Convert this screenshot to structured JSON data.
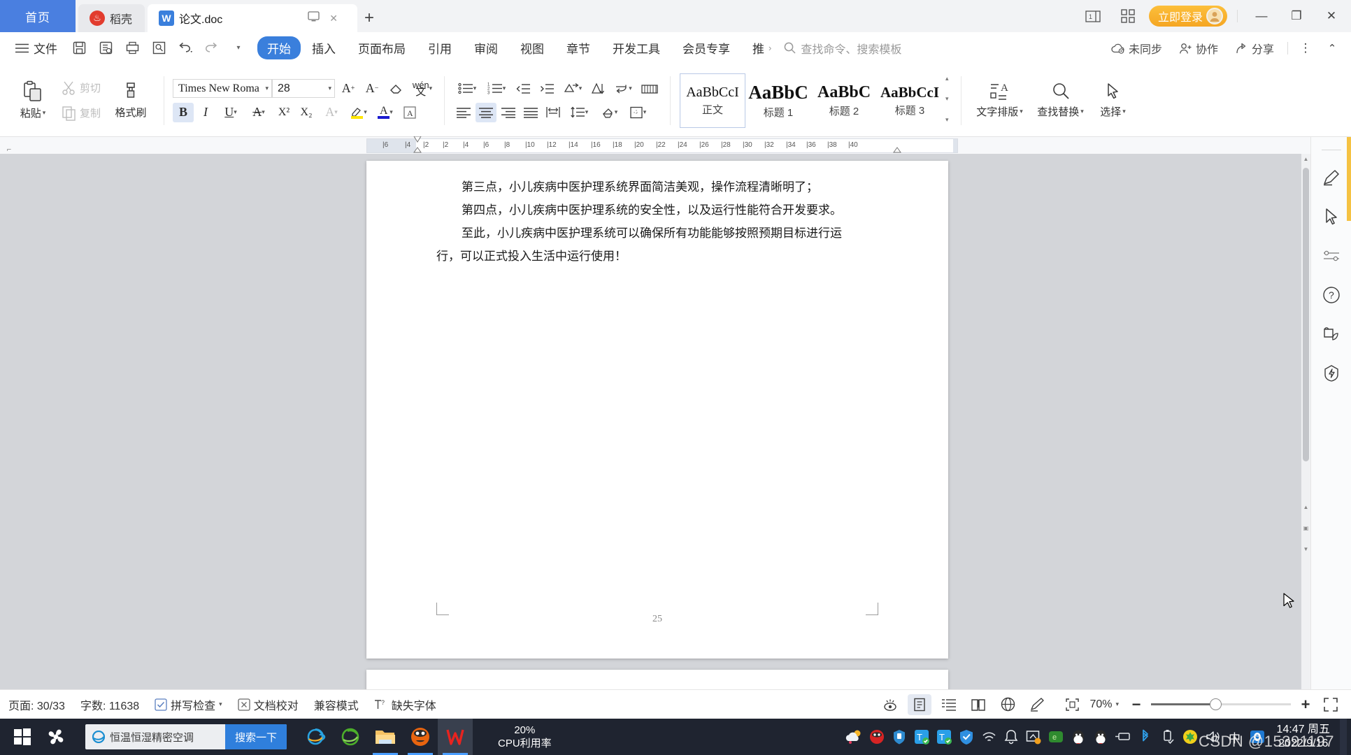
{
  "window": {
    "tabs": [
      {
        "id": "home",
        "label": "首页",
        "icon": "home-tab",
        "active": false
      },
      {
        "id": "docer",
        "label": "稻壳",
        "icon": "docer-icon",
        "active": false
      },
      {
        "id": "doc1",
        "label": "论文.doc",
        "icon": "wps-writer-icon",
        "active": true
      }
    ],
    "new_tab_label": "+",
    "cast_icon": "cast-icon",
    "layout_icon": "single-page-layout-icon",
    "grid_icon": "app-grid-icon",
    "login_label": "立即登录",
    "minimize": "—",
    "maximize": "❐",
    "close": "✕"
  },
  "menubar": {
    "file_label": "文件",
    "quick_access": [
      "save-icon",
      "save-as-icon",
      "print-icon",
      "print-preview-icon",
      "undo-icon",
      "redo-icon",
      "customize-icon"
    ],
    "items": [
      {
        "label": "开始",
        "active": true
      },
      {
        "label": "插入",
        "active": false
      },
      {
        "label": "页面布局",
        "active": false
      },
      {
        "label": "引用",
        "active": false
      },
      {
        "label": "审阅",
        "active": false
      },
      {
        "label": "视图",
        "active": false
      },
      {
        "label": "章节",
        "active": false
      },
      {
        "label": "开发工具",
        "active": false
      },
      {
        "label": "会员专享",
        "active": false
      },
      {
        "label": "推",
        "active": false
      }
    ],
    "overflow_label": "›",
    "search_placeholder": "查找命令、搜索模板",
    "right_items": [
      {
        "label": "未同步",
        "icon": "cloud-sync-icon"
      },
      {
        "label": "协作",
        "icon": "collaborate-icon"
      },
      {
        "label": "分享",
        "icon": "share-icon"
      }
    ],
    "more_icon": "more-vertical-icon",
    "collapse_icon": "collapse-ribbon-icon"
  },
  "ribbon": {
    "clipboard": {
      "paste_label": "粘贴",
      "cut_label": "剪切",
      "copy_label": "复制",
      "format_painter_label": "格式刷"
    },
    "font": {
      "family": "Times New Roma",
      "size": "28",
      "grow_icon": "increase-font-size-icon",
      "shrink_icon": "decrease-font-size-icon",
      "clear_format_icon": "clear-formatting-icon",
      "pinyin_icon": "pinyin-guide-icon",
      "bold": "B",
      "italic": "I",
      "underline": "U",
      "strikethrough": "A",
      "superscript": "X²",
      "subscript": "X₂",
      "text_effects": "A",
      "highlight_icon": "highlight-color-icon",
      "font_color_icon": "font-color-icon",
      "char_border_icon": "character-border-icon",
      "bold_active": true
    },
    "paragraph": {
      "bullets_icon": "bullet-list-icon",
      "numbering_icon": "numbered-list-icon",
      "decrease_indent_icon": "decrease-indent-icon",
      "increase_indent_icon": "increase-indent-icon",
      "smart_layout_icon": "smart-typography-icon",
      "sort_icon": "sort-icon",
      "show_marks_icon": "show-paragraph-marks-icon",
      "table_grid_icon": "table-grid-icon",
      "align_left_icon": "align-left-icon",
      "align_center_icon": "align-center-icon",
      "align_right_icon": "align-right-icon",
      "justify_icon": "justify-icon",
      "distribute_icon": "distribute-icon",
      "line_spacing_icon": "line-spacing-icon",
      "shading_icon": "shading-icon",
      "borders_icon": "borders-icon",
      "align_center_active": true
    },
    "styles": [
      {
        "preview": "AaBbCcI",
        "name": "正文",
        "selected": true,
        "size": "20px",
        "weight": "normal"
      },
      {
        "preview": "AaBbC",
        "name": "标题 1",
        "selected": false,
        "size": "27px",
        "weight": "bold"
      },
      {
        "preview": "AaBbC",
        "name": "标题 2",
        "selected": false,
        "size": "24px",
        "weight": "bold"
      },
      {
        "preview": "AaBbCcI",
        "name": "标题 3",
        "selected": false,
        "size": "21px",
        "weight": "bold"
      }
    ],
    "text_layout_label": "文字排版",
    "find_replace_label": "查找替换",
    "select_label": "选择"
  },
  "ruler": {
    "ticks": [
      "6",
      "4",
      "2",
      "2",
      "4",
      "6",
      "8",
      "10",
      "12",
      "14",
      "16",
      "18",
      "20",
      "22",
      "24",
      "26",
      "28",
      "30",
      "32",
      "34",
      "36",
      "38",
      "40"
    ]
  },
  "document": {
    "paragraphs": [
      "第三点，小儿疾病中医护理系统界面简洁美观，操作流程清晰明了；",
      "第四点，小儿疾病中医护理系统的安全性，以及运行性能符合开发要求。",
      "至此，小儿疾病中医护理系统可以确保所有功能能够按照预期目标进行运",
      "行，可以正式投入生活中运行使用！"
    ],
    "page_number": "25"
  },
  "right_panel": {
    "items": [
      {
        "icon": "brush-pen-icon",
        "name": "style-brush"
      },
      {
        "icon": "cursor-select-icon",
        "name": "select-tool"
      },
      {
        "icon": "sliders-icon",
        "name": "settings-sliders"
      },
      {
        "icon": "help-circle-icon",
        "name": "help"
      },
      {
        "icon": "leaf-shield-icon",
        "name": "eco-mode"
      },
      {
        "icon": "lightning-badge-icon",
        "name": "quick-action"
      }
    ]
  },
  "statusbar": {
    "page_label": "页面: 30/33",
    "words_label": "字数: 11638",
    "spellcheck_label": "拼写检查",
    "proofread_label": "文档校对",
    "compat_label": "兼容模式",
    "missing_font_label": "缺失字体",
    "view_icons": [
      "focus-eye-icon",
      "print-layout-icon",
      "outline-view-icon",
      "reading-layout-icon",
      "web-layout-icon",
      "markup-pen-icon"
    ],
    "fit_icon": "fit-page-icon",
    "zoom_label": "70%",
    "zoom_out": "−",
    "zoom_in": "+",
    "fullscreen_icon": "fullscreen-icon"
  },
  "taskbar": {
    "start_icon": "windows-start-icon",
    "fan_icon": "fan-app-icon",
    "search_value": "恒温恒湿精密空调",
    "search_button": "搜索一下",
    "apps": [
      {
        "icon": "internet-explorer-icon",
        "name": "ie-browser",
        "running": false,
        "active": false
      },
      {
        "icon": "green-browser-icon",
        "name": "green-browser",
        "running": false,
        "active": false
      },
      {
        "icon": "file-explorer-icon",
        "name": "file-explorer",
        "running": true,
        "active": false
      },
      {
        "icon": "mask-browser-icon",
        "name": "mask-browser",
        "running": true,
        "active": false
      },
      {
        "icon": "wps-writer-icon",
        "name": "wps-office",
        "running": true,
        "active": true
      }
    ],
    "cpu_value": "20%",
    "cpu_label": "CPU利用率",
    "tray": [
      "weather-icon",
      "mask-app-icon",
      "usb-shield-icon",
      "tencent-pc-icon",
      "tencent-pc-2-icon",
      "security-shield-icon",
      "wifi-icon",
      "bell-icon",
      "screenshot-icon",
      "green-app-icon",
      "qq-icon",
      "qq-2-icon",
      "usb-device-icon",
      "bluetooth-icon",
      "usb-eject-icon",
      "wallet-icon",
      "volume-icon",
      "ime-chinese-icon",
      "outlook-icon"
    ],
    "ime_label": "中",
    "clock_time": "14:47 周五",
    "clock_date": "2022/9/16",
    "watermark": "CSDN @15391197"
  }
}
